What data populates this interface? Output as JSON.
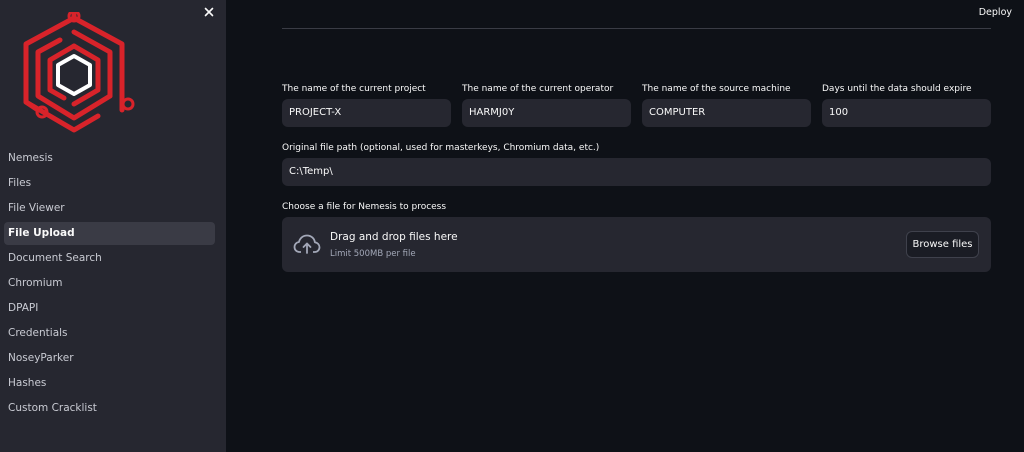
{
  "sidebar": {
    "items": [
      {
        "label": "Nemesis",
        "active": false
      },
      {
        "label": "Files",
        "active": false
      },
      {
        "label": "File Viewer",
        "active": false
      },
      {
        "label": "File Upload",
        "active": true
      },
      {
        "label": "Document Search",
        "active": false
      },
      {
        "label": "Chromium",
        "active": false
      },
      {
        "label": "DPAPI",
        "active": false
      },
      {
        "label": "Credentials",
        "active": false
      },
      {
        "label": "NoseyParker",
        "active": false
      },
      {
        "label": "Hashes",
        "active": false
      },
      {
        "label": "Custom Cracklist",
        "active": false
      }
    ]
  },
  "header": {
    "deploy_label": "Deploy"
  },
  "form": {
    "project": {
      "label": "The name of the current project",
      "value": "PROJECT-X"
    },
    "operator": {
      "label": "The name of the current operator",
      "value": "HARMJ0Y"
    },
    "source": {
      "label": "The name of the source machine",
      "value": "COMPUTER"
    },
    "expire": {
      "label": "Days until the data should expire",
      "value": "100"
    },
    "path": {
      "label": "Original file path (optional, used for masterkeys, Chromium data, etc.)",
      "value": "C:\\Temp\\"
    },
    "upload": {
      "label": "Choose a file for Nemesis to process",
      "drop_title": "Drag and drop files here",
      "drop_limit": "Limit 500MB per file",
      "browse_label": "Browse files"
    }
  },
  "colors": {
    "logo_red": "#d8232a",
    "sidebar_bg": "#262730",
    "main_bg": "#0e1117"
  },
  "icons": [
    "close-icon",
    "nemesis-logo",
    "cloud-upload-icon"
  ]
}
